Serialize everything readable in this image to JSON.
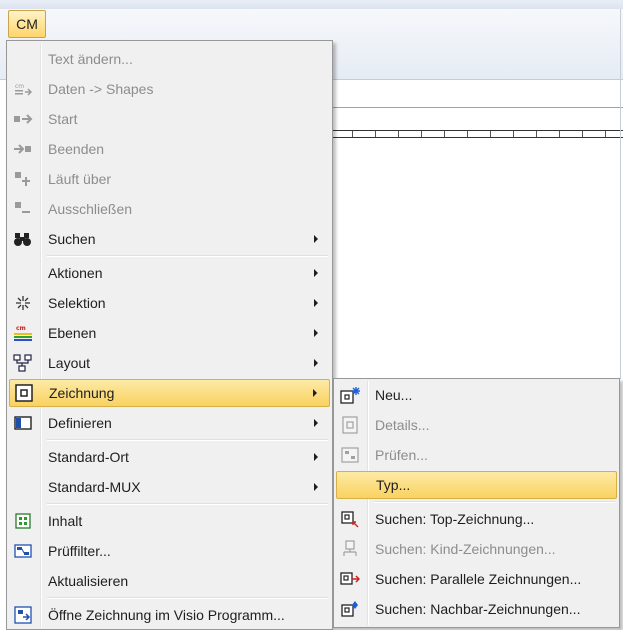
{
  "ribbon": {
    "tab_label": "CM"
  },
  "main_menu": {
    "items": [
      {
        "label": "Text ändern...",
        "icon": "text-edit-icon",
        "enabled": false,
        "submenu": false
      },
      {
        "label": "Daten -> Shapes",
        "icon": "data-shapes-icon",
        "enabled": false,
        "submenu": false
      },
      {
        "label": "Start",
        "icon": "start-icon",
        "enabled": false,
        "submenu": false
      },
      {
        "label": "Beenden",
        "icon": "end-icon",
        "enabled": false,
        "submenu": false
      },
      {
        "label": "Läuft über",
        "icon": "runs-over-icon",
        "enabled": false,
        "submenu": false
      },
      {
        "label": "Ausschließen",
        "icon": "exclude-icon",
        "enabled": false,
        "submenu": false
      },
      {
        "label": "Suchen",
        "icon": "binoculars-icon",
        "enabled": true,
        "submenu": true
      },
      {
        "label": "Aktionen",
        "icon": "",
        "enabled": true,
        "submenu": true
      },
      {
        "label": "Selektion",
        "icon": "selection-icon",
        "enabled": true,
        "submenu": true
      },
      {
        "label": "Ebenen",
        "icon": "layers-icon",
        "enabled": true,
        "submenu": true
      },
      {
        "label": "Layout",
        "icon": "layout-icon",
        "enabled": true,
        "submenu": true
      },
      {
        "label": "Zeichnung",
        "icon": "drawing-icon",
        "enabled": true,
        "submenu": true,
        "highlighted": true
      },
      {
        "label": "Definieren",
        "icon": "define-icon",
        "enabled": true,
        "submenu": true
      },
      {
        "label": "Standard-Ort",
        "icon": "",
        "enabled": true,
        "submenu": true
      },
      {
        "label": "Standard-MUX",
        "icon": "",
        "enabled": true,
        "submenu": true
      },
      {
        "label": "Inhalt",
        "icon": "content-icon",
        "enabled": true,
        "submenu": false
      },
      {
        "label": "Prüffilter...",
        "icon": "check-filter-icon",
        "enabled": true,
        "submenu": false
      },
      {
        "label": "Aktualisieren",
        "icon": "",
        "enabled": true,
        "submenu": false
      },
      {
        "label": "Öffne Zeichnung im Visio Programm...",
        "icon": "visio-open-icon",
        "enabled": true,
        "submenu": false
      }
    ]
  },
  "sub_menu": {
    "items": [
      {
        "label": "Neu...",
        "icon": "new-drawing-icon",
        "enabled": true
      },
      {
        "label": "Details...",
        "icon": "details-icon",
        "enabled": false
      },
      {
        "label": "Prüfen...",
        "icon": "check-icon",
        "enabled": false
      },
      {
        "label": "Typ...",
        "icon": "",
        "enabled": true,
        "highlighted": true
      },
      {
        "label": "Suchen: Top-Zeichnung...",
        "icon": "find-top-icon",
        "enabled": true
      },
      {
        "label": "Suchen: Kind-Zeichnungen...",
        "icon": "find-children-icon",
        "enabled": false
      },
      {
        "label": "Suchen: Parallele Zeichnungen...",
        "icon": "find-parallel-icon",
        "enabled": true
      },
      {
        "label": "Suchen: Nachbar-Zeichnungen...",
        "icon": "find-neighbor-icon",
        "enabled": true
      }
    ]
  },
  "colors": {
    "highlight_top": "#fdeaa6",
    "highlight_bottom": "#f9d25f",
    "menu_bg": "#f0f0f0",
    "disabled_text": "#8d8d8d"
  }
}
